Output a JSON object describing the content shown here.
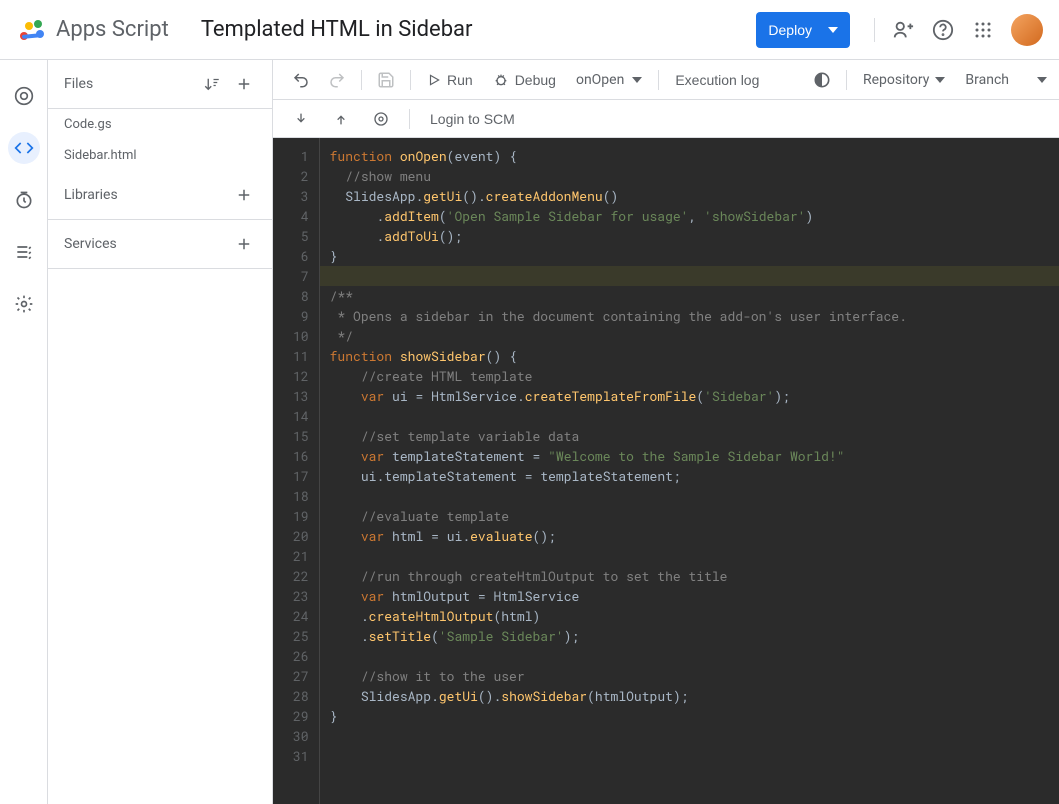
{
  "header": {
    "app_name": "Apps Script",
    "project_title": "Templated HTML in Sidebar",
    "deploy_label": "Deploy"
  },
  "files_panel": {
    "files_label": "Files",
    "libraries_label": "Libraries",
    "services_label": "Services",
    "files": [
      "Code.gs",
      "Sidebar.html"
    ]
  },
  "toolbar": {
    "run_label": "Run",
    "debug_label": "Debug",
    "function_selected": "onOpen",
    "execution_log_label": "Execution log",
    "repository_label": "Repository",
    "branch_label": "Branch",
    "login_scm_label": "Login to SCM"
  },
  "code": {
    "lines": [
      {
        "n": 1,
        "html": "<span class='kw'>function</span> <span class='fn'>onOpen</span><span class='punct'>(</span><span class='param'>event</span><span class='punct'>) {</span>"
      },
      {
        "n": 2,
        "html": "  <span class='com'>//show menu</span>"
      },
      {
        "n": 3,
        "html": "  <span class='cls'>SlidesApp</span><span class='punct'>.</span><span class='fn'>getUi</span><span class='punct'>().</span><span class='fn'>createAddonMenu</span><span class='punct'>()</span>"
      },
      {
        "n": 4,
        "html": "      <span class='punct'>.</span><span class='fn'>addItem</span><span class='punct'>(</span><span class='str'>'Open Sample Sidebar for usage'</span><span class='punct'>, </span><span class='str'>'showSidebar'</span><span class='punct'>)</span>"
      },
      {
        "n": 5,
        "html": "      <span class='punct'>.</span><span class='fn'>addToUi</span><span class='punct'>();</span>"
      },
      {
        "n": 6,
        "html": "<span class='punct'>}</span>"
      },
      {
        "n": 7,
        "html": "",
        "hl": true
      },
      {
        "n": 8,
        "html": "<span class='com'>/**</span>"
      },
      {
        "n": 9,
        "html": "<span class='com'> * Opens a sidebar in the document containing the add-on's user interface.</span>"
      },
      {
        "n": 10,
        "html": "<span class='com'> */</span>"
      },
      {
        "n": 11,
        "html": "<span class='kw'>function</span> <span class='fn'>showSidebar</span><span class='punct'>() {</span>"
      },
      {
        "n": 12,
        "html": "    <span class='com'>//create HTML template</span>"
      },
      {
        "n": 13,
        "html": "    <span class='kw'>var</span> <span class='param'>ui</span> <span class='punct'>=</span> <span class='cls'>HtmlService</span><span class='punct'>.</span><span class='fn'>createTemplateFromFile</span><span class='punct'>(</span><span class='str'>'Sidebar'</span><span class='punct'>);</span>"
      },
      {
        "n": 14,
        "html": ""
      },
      {
        "n": 15,
        "html": "    <span class='com'>//set template variable data</span>"
      },
      {
        "n": 16,
        "html": "    <span class='kw'>var</span> <span class='param'>templateStatement</span> <span class='punct'>=</span> <span class='str'>\"Welcome to the Sample Sidebar World!\"</span>"
      },
      {
        "n": 17,
        "html": "    <span class='param'>ui</span><span class='punct'>.</span><span class='param'>templateStatement</span> <span class='punct'>=</span> <span class='param'>templateStatement</span><span class='punct'>;</span>"
      },
      {
        "n": 18,
        "html": ""
      },
      {
        "n": 19,
        "html": "    <span class='com'>//evaluate template</span>"
      },
      {
        "n": 20,
        "html": "    <span class='kw'>var</span> <span class='param'>html</span> <span class='punct'>=</span> <span class='param'>ui</span><span class='punct'>.</span><span class='fn'>evaluate</span><span class='punct'>();</span>"
      },
      {
        "n": 21,
        "html": ""
      },
      {
        "n": 22,
        "html": "    <span class='com'>//run through createHtmlOutput to set the title</span>"
      },
      {
        "n": 23,
        "html": "    <span class='kw'>var</span> <span class='param'>htmlOutput</span> <span class='punct'>=</span> <span class='cls'>HtmlService</span>"
      },
      {
        "n": 24,
        "html": "    <span class='punct'>.</span><span class='fn'>createHtmlOutput</span><span class='punct'>(</span><span class='param'>html</span><span class='punct'>)</span>"
      },
      {
        "n": 25,
        "html": "    <span class='punct'>.</span><span class='fn'>setTitle</span><span class='punct'>(</span><span class='str'>'Sample Sidebar'</span><span class='punct'>);</span>"
      },
      {
        "n": 26,
        "html": ""
      },
      {
        "n": 27,
        "html": "    <span class='com'>//show it to the user</span>"
      },
      {
        "n": 28,
        "html": "    <span class='cls'>SlidesApp</span><span class='punct'>.</span><span class='fn'>getUi</span><span class='punct'>().</span><span class='fn'>showSidebar</span><span class='punct'>(</span><span class='param'>htmlOutput</span><span class='punct'>);</span>"
      },
      {
        "n": 29,
        "html": "<span class='punct'>}</span>"
      },
      {
        "n": 30,
        "html": ""
      },
      {
        "n": 31,
        "html": ""
      }
    ]
  }
}
